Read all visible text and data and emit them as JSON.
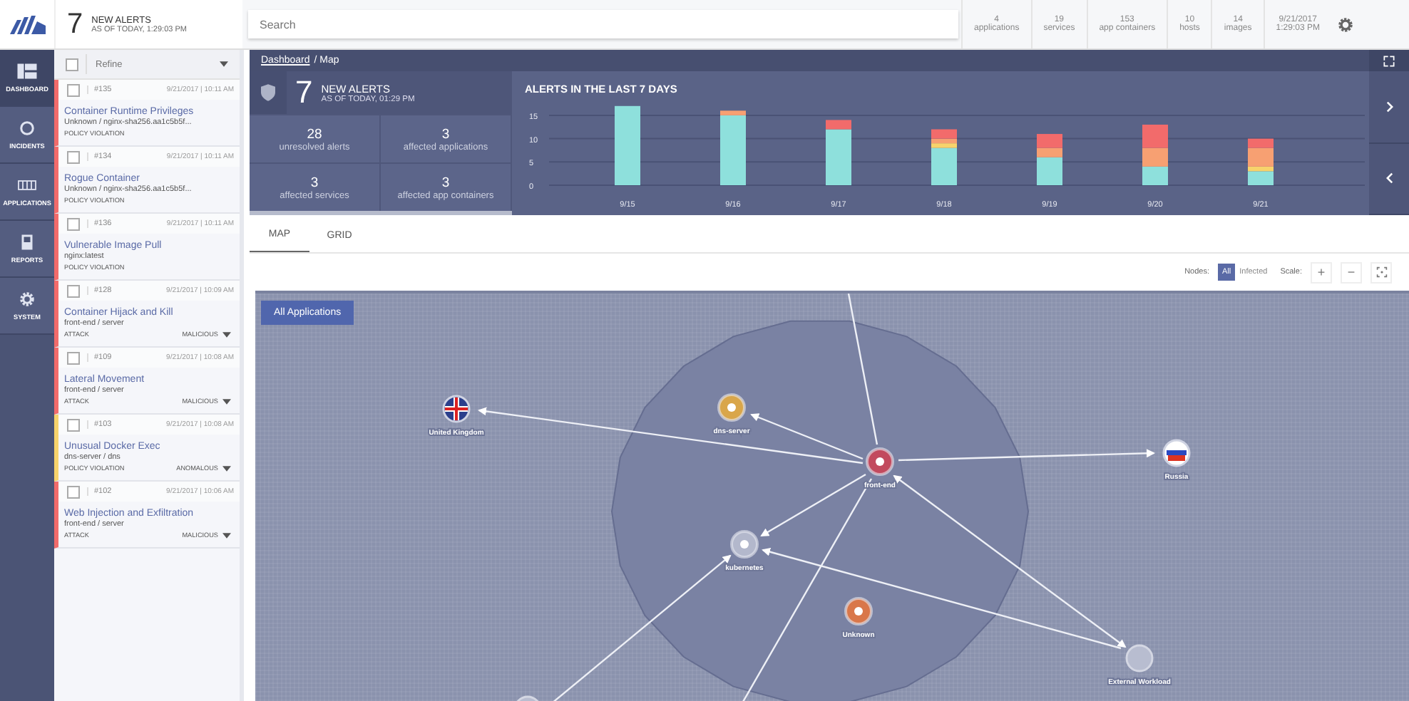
{
  "top_bar": {
    "alert_count": "7",
    "alert_title": "NEW ALERTS",
    "alert_time": "AS OF TODAY, 1:29:03 PM",
    "search": {
      "placeholder": "Search"
    },
    "stats": [
      {
        "value": "4",
        "label": "applications"
      },
      {
        "value": "19",
        "label": "services"
      },
      {
        "value": "153",
        "label": "app containers"
      },
      {
        "value": "10",
        "label": "hosts"
      },
      {
        "value": "14",
        "label": "images"
      }
    ],
    "date": "9/21/2017",
    "time": "1:29:03 PM"
  },
  "nav": [
    {
      "label": "DASHBOARD",
      "kind": "dashboard",
      "selected": true
    },
    {
      "label": "INCIDENTS",
      "kind": "incidents",
      "selected": false
    },
    {
      "label": "APPLICATIONS",
      "kind": "applications",
      "selected": false
    },
    {
      "label": "REPORTS",
      "kind": "reports",
      "selected": false
    },
    {
      "label": "SYSTEM",
      "kind": "system",
      "selected": false
    }
  ],
  "alerts": {
    "refine": {
      "placeholder": "Refine",
      "checked": false
    },
    "items": [
      {
        "id": "#135",
        "time": "9/21/2017 | 10:11 AM",
        "title": "Container Runtime Privileges",
        "source": "Unknown / nginx-sha256.aa1c5b5f...",
        "category": "POLICY VIOLATION",
        "color": "#f26b6b",
        "checked": false
      },
      {
        "id": "#134",
        "time": "9/21/2017 | 10:11 AM",
        "title": "Rogue Container",
        "source": "Unknown / nginx-sha256.aa1c5b5f...",
        "category": "POLICY VIOLATION",
        "color": "#f26b6b",
        "checked": false
      },
      {
        "id": "#136",
        "time": "9/21/2017 | 10:11 AM",
        "title": "Vulnerable Image Pull",
        "source": "nginx:latest",
        "category": "POLICY VIOLATION",
        "color": "#f26b6b",
        "checked": false
      },
      {
        "id": "#128",
        "time": "9/21/2017 | 10:09 AM",
        "title": "Container Hijack and Kill",
        "source": "front-end / server",
        "category": "ATTACK",
        "severity": "MALICIOUS",
        "color": "#f26b6b",
        "checked": false
      },
      {
        "id": "#109",
        "time": "9/21/2017 | 10:08 AM",
        "title": "Lateral Movement",
        "source": "front-end / server",
        "category": "ATTACK",
        "severity": "MALICIOUS",
        "color": "#f26b6b",
        "checked": false
      },
      {
        "id": "#103",
        "time": "9/21/2017 | 10:08 AM",
        "title": "Unusual Docker Exec",
        "source": "dns-server / dns",
        "category": "POLICY VIOLATION",
        "severity": "ANOMALOUS",
        "color": "#f7d36b",
        "checked": false
      },
      {
        "id": "#102",
        "time": "9/21/2017 | 10:06 AM",
        "title": "Web Injection and Exfiltration",
        "source": "front-end / server",
        "category": "ATTACK",
        "severity": "MALICIOUS",
        "color": "#f26b6b",
        "checked": false
      }
    ]
  },
  "breadcrumb": {
    "link": "Dashboard",
    "current": "/ Map"
  },
  "summary": {
    "count": "7",
    "title": "NEW ALERTS",
    "time": "AS OF TODAY, 01:29 PM",
    "stats": [
      {
        "value": "28",
        "label": "unresolved alerts"
      },
      {
        "value": "3",
        "label": "affected applications"
      },
      {
        "value": "3",
        "label": "affected services"
      },
      {
        "value": "3",
        "label": "affected app containers"
      }
    ]
  },
  "chart": {
    "chart_data": {
      "type": "bar",
      "title": "ALERTS IN THE LAST 7 DAYS",
      "stacked": true,
      "grid": true,
      "categories": [
        "9/15",
        "9/16",
        "9/17",
        "9/18",
        "9/19",
        "9/20",
        "9/21"
      ],
      "yticks": [
        0,
        5,
        10,
        15
      ],
      "ylim": [
        0,
        17
      ],
      "series": [
        {
          "color": "#8ee0dc",
          "values": [
            17,
            15,
            12,
            8,
            6,
            4,
            3
          ]
        },
        {
          "color": "#f7d36b",
          "values": [
            0,
            0,
            0,
            1,
            0,
            0,
            1
          ]
        },
        {
          "color": "#f7a072",
          "values": [
            0,
            1,
            0,
            1,
            2,
            4,
            4
          ]
        },
        {
          "color": "#f26b6b",
          "values": [
            0,
            0,
            2,
            2,
            3,
            5,
            2
          ]
        }
      ]
    }
  },
  "tabs": [
    {
      "label": "MAP",
      "selected": true
    },
    {
      "label": "GRID",
      "selected": false
    }
  ],
  "toolbar": {
    "nodes_label": "Nodes:",
    "filters": [
      {
        "label": "All",
        "selected": true
      },
      {
        "label": "Infected",
        "selected": false
      }
    ],
    "scale_label": "Scale:",
    "zoom_in": "+",
    "zoom_out": "−"
  },
  "map": {
    "scope_button": "All Applications",
    "nodes": [
      {
        "kind": "flag-uk",
        "label": "United Kingdom"
      },
      {
        "kind": "service",
        "label": "dns-server",
        "color": "#d9a64a"
      },
      {
        "kind": "service",
        "label": "front-end",
        "color": "#c24a5e"
      },
      {
        "kind": "flag-ru",
        "label": "Russia"
      },
      {
        "kind": "service",
        "label": "kubernetes",
        "color": "#b3b8cc"
      },
      {
        "kind": "service",
        "label": "Unknown",
        "color": "#d9774a"
      },
      {
        "kind": "external",
        "label": "External Workload"
      },
      {
        "kind": "external"
      }
    ]
  }
}
